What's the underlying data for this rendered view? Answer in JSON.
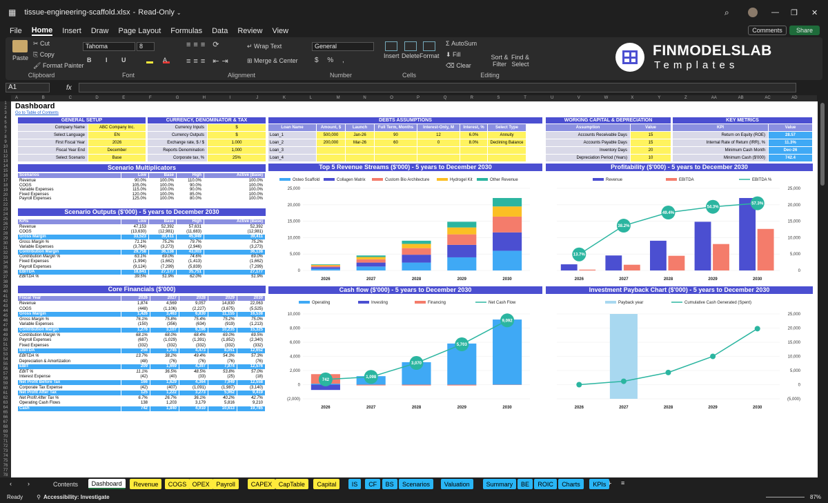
{
  "window": {
    "file_name": "tissue-engineering-scaffold.xlsx",
    "mode": "Read-Only"
  },
  "menu": [
    "File",
    "Home",
    "Insert",
    "Draw",
    "Page Layout",
    "Formulas",
    "Data",
    "Review",
    "View"
  ],
  "buttons": {
    "comments": "Comments",
    "share": "Share"
  },
  "ribbon": {
    "paste": "Paste",
    "cut": "Cut",
    "copy": "Copy",
    "format_painter": "Format Painter",
    "clipboard": "Clipboard",
    "font_name": "Tahoma",
    "font_size": "8",
    "font": "Font",
    "wrap": "Wrap Text",
    "merge": "Merge & Center",
    "alignment": "Alignment",
    "number_format": "General",
    "number": "Number",
    "insert": "Insert",
    "delete": "Delete",
    "format": "Format",
    "cells": "Cells",
    "autosum": "AutoSum",
    "fill": "Fill",
    "clear": "Clear",
    "sort": "Sort & Filter",
    "find": "Find & Select",
    "editing": "Editing"
  },
  "brand": {
    "name": "FINMODELSLAB",
    "sub": "Templates"
  },
  "name_box": "A1",
  "columns": [
    "A",
    "B",
    "C",
    "D",
    "E",
    "F",
    "G",
    "H",
    "I",
    "J",
    "K",
    "L",
    "M",
    "N",
    "O",
    "P",
    "Q",
    "R",
    "S",
    "T",
    "U",
    "V",
    "W",
    "X",
    "Y",
    "Z",
    "AA",
    "AB",
    "AC",
    "AD"
  ],
  "sheet": {
    "title": "Dashboard",
    "link": "Go to Table of Contents",
    "general": {
      "title": "GENERAL SETUP",
      "rows": [
        [
          "Company Name",
          "ABC Company Inc."
        ],
        [
          "Select Language",
          "EN"
        ],
        [
          "First Fiscal Year",
          "2026"
        ],
        [
          "Fiscal Year End",
          "December"
        ],
        [
          "Select Scenario",
          "Base"
        ]
      ]
    },
    "currency": {
      "title": "CURRENCY, DENOMINATOR & TAX",
      "rows": [
        [
          "Currency Inputs",
          "$"
        ],
        [
          "Currency Outputs",
          "$"
        ],
        [
          "Exchange rate, $ / $",
          "1.000"
        ],
        [
          "Reports Denomination",
          "1,000"
        ],
        [
          "Corporate tax, %",
          "25%"
        ]
      ]
    },
    "debts": {
      "title": "DEBTS ASSUMPTIONS",
      "headers": [
        "Loan Name",
        "Amount, $",
        "Launch",
        "Full Term, Months",
        "Interest-Only, M",
        "Interest, %",
        "Select Type"
      ],
      "rows": [
        [
          "Loan_1",
          "500,000",
          "Jan-26",
          "90",
          "12",
          "6.0%",
          "Annuity"
        ],
        [
          "Loan_2",
          "200,000",
          "Mar-26",
          "60",
          "0",
          "8.0%",
          "Declining Balance"
        ],
        [
          "Loan_3",
          "",
          "",
          "",
          "",
          "",
          ""
        ],
        [
          "Loan_4",
          "",
          "",
          "",
          "",
          "",
          ""
        ]
      ]
    },
    "wc": {
      "title": "WORKING CAPITAL & DEPRECIATION",
      "headers": [
        "Assumption",
        "Value"
      ],
      "rows": [
        [
          "Accounts Receivable Days",
          "15"
        ],
        [
          "Accounts Payable Days",
          "15"
        ],
        [
          "Inventory Days",
          "20"
        ],
        [
          "Depreciation Period (Years)",
          "10"
        ]
      ]
    },
    "kpi": {
      "title": "KEY METRICS",
      "headers": [
        "KPI",
        "Value"
      ],
      "rows": [
        [
          "Return on Equity (ROE)",
          "28.57"
        ],
        [
          "Internal Rate of Return (IRR), %",
          "11.3%"
        ],
        [
          "Minimum Cash Month",
          "Dec-26"
        ],
        [
          "Minimum Cash ($'000)",
          "742.4"
        ]
      ]
    },
    "multipliers": {
      "title": "Scenario Multiplicators",
      "headers": [
        "Scenarios",
        "Low",
        "Base",
        "High",
        "Active (Base)"
      ],
      "rows": [
        [
          "Revenue",
          "90.0%",
          "100.0%",
          "110.0%",
          "100.0%"
        ],
        [
          "COGS",
          "105.0%",
          "100.0%",
          "90.0%",
          "100.0%"
        ],
        [
          "Variable Expenses",
          "115.0%",
          "100.0%",
          "90.0%",
          "100.0%"
        ],
        [
          "Fixed Expenses",
          "120.0%",
          "100.0%",
          "85.0%",
          "100.0%"
        ],
        [
          "Payroll Expenses",
          "125.0%",
          "100.0%",
          "80.0%",
          "100.0%"
        ]
      ]
    },
    "outputs": {
      "title": "Scenario Outputs ($'000) - 5 years to December 2030",
      "headers": [
        "KPIs",
        "Low",
        "Base",
        "High",
        "Active (Base)"
      ],
      "rows": [
        [
          "Revenue",
          "47,153",
          "52,392",
          "57,631",
          "52,392",
          ""
        ],
        [
          "COGS",
          "(13,630)",
          "(12,981)",
          "(11,683)",
          "(12,981)",
          ""
        ],
        [
          "Gross Margin",
          "33,523",
          "39,411",
          "45,949",
          "39,411",
          "b"
        ],
        [
          "Gross Margin %",
          "71.1%",
          "75.2%",
          "79.7%",
          "75.2%",
          "i"
        ],
        [
          "Variable Expenses",
          "(3,764)",
          "(3,273)",
          "(2,946)",
          "(3,273)",
          ""
        ],
        [
          "Contribution Margin",
          "29,758",
          "36,138",
          "43,003",
          "36,138",
          "b"
        ],
        [
          "Contribution Margin %",
          "63.1%",
          "69.0%",
          "74.6%",
          "69.0%",
          "i"
        ],
        [
          "Fixed Expenses",
          "(1,994)",
          "(1,662)",
          "(1,413)",
          "(1,662)",
          ""
        ],
        [
          "Payroll Expenses",
          "(9,124)",
          "(7,299)",
          "(5,839)",
          "(7,299)",
          ""
        ],
        [
          "EBITDA",
          "18,641",
          "27,177",
          "35,751",
          "27,177",
          "b"
        ],
        [
          "EBITDA %",
          "39.5%",
          "51.9%",
          "62.0%",
          "51.9%",
          "i"
        ]
      ]
    },
    "core": {
      "title": "Core Financials ($'000)",
      "headers": [
        "Fiscal Year",
        "2026",
        "2027",
        "2028",
        "2029",
        "2030"
      ],
      "rows": [
        [
          "Revenue",
          "1,874",
          "4,569",
          "9,057",
          "14,830",
          "22,063",
          ""
        ],
        [
          "COGS",
          "(448)",
          "(1,106)",
          "(2,227)",
          "(3,675)",
          "(5,525)",
          ""
        ],
        [
          "Gross Margin",
          "1,426",
          "3,463",
          "6,830",
          "11,155",
          "16,538",
          "b"
        ],
        [
          "Gross Margin %",
          "76.1%",
          "75.8%",
          "75.4%",
          "75.2%",
          "75.0%",
          "i"
        ],
        [
          "Variable Expenses",
          "(150)",
          "(356)",
          "(634)",
          "(919)",
          "(1,213)",
          ""
        ],
        [
          "Contribution Margin",
          "1,276",
          "3,107",
          "6,196",
          "10,235",
          "15,325",
          "b"
        ],
        [
          "Contribution Margin %",
          "68.1%",
          "68.0%",
          "68.4%",
          "69.0%",
          "69.5%",
          "i"
        ],
        [
          "Payroll Expenses",
          "(687)",
          "(1,029)",
          "(1,391)",
          "(1,852)",
          "(2,340)",
          ""
        ],
        [
          "Fixed Expenses",
          "(332)",
          "(332)",
          "(332)",
          "(332)",
          "(332)",
          ""
        ],
        [
          "EBITDA",
          "256",
          "1,745",
          "4,473",
          "8,051",
          "12,652",
          "b"
        ],
        [
          "EBITDA %",
          "13.7%",
          "38.2%",
          "49.4%",
          "54.3%",
          "57.3%",
          "i"
        ],
        [
          "Depreciation & Amortization",
          "(48)",
          "(76)",
          "(76)",
          "(76)",
          "(76)",
          ""
        ],
        [
          "EBIT",
          "209",
          "1,669",
          "4,397",
          "7,974",
          "12,576",
          "b"
        ],
        [
          "EBIT %",
          "11.1%",
          "36.5%",
          "48.5%",
          "53.8%",
          "57.0%",
          "i"
        ],
        [
          "Interest Expense",
          "(42)",
          "(40)",
          "(33)",
          "(25)",
          "(18)",
          ""
        ],
        [
          "Net Profit Before Tax",
          "166",
          "1,629",
          "4,364",
          "7,949",
          "12,558",
          "b"
        ],
        [
          "Corporate Tax Expense",
          "(42)",
          "(407)",
          "(1,091)",
          "(1,987)",
          "(3,140)",
          ""
        ],
        [
          "Net Profit After Tax",
          "125",
          "1,222",
          "3,273",
          "5,962",
          "9,419",
          "b"
        ],
        [
          "Net Profit After Tax %",
          "6.7%",
          "26.7%",
          "36.1%",
          "40.2%",
          "42.7%",
          "i"
        ],
        [
          "Operating Cash Flows",
          "138",
          "1,203",
          "3,179",
          "5,816",
          "9,210",
          ""
        ],
        [
          "Cash",
          "742",
          "1,840",
          "4,910",
          "10,613",
          "19,785",
          "y"
        ]
      ]
    }
  },
  "chart_data": [
    {
      "type": "bar",
      "title": "Top 5 Revenue Streams ($'000) - 5 years to December 2030",
      "categories": [
        "2026",
        "2027",
        "2028",
        "2029",
        "2030"
      ],
      "ylim": [
        0,
        25000
      ],
      "yticks": [
        "0",
        "5,000",
        "10,000",
        "15,000",
        "20,000",
        "25,000"
      ],
      "series": [
        {
          "name": "Osteo Scaffold",
          "color": "#3fa9f5",
          "values": [
            500,
            1200,
            2400,
            4000,
            6000
          ]
        },
        {
          "name": "Collagen Matrix",
          "color": "#4b4fd1",
          "values": [
            500,
            1200,
            2400,
            3800,
            5600
          ]
        },
        {
          "name": "Custom Bio Architecture",
          "color": "#f47c6b",
          "values": [
            400,
            1000,
            2000,
            3200,
            4800
          ]
        },
        {
          "name": "Hydrogel Kit",
          "color": "#fbbf24",
          "values": [
            300,
            700,
            1300,
            2100,
            3100
          ]
        },
        {
          "name": "Other Revenue",
          "color": "#2bb5a0",
          "values": [
            174,
            469,
            957,
            1730,
            2563
          ]
        }
      ]
    },
    {
      "type": "bar",
      "title": "Profitability ($'000) - 5 years to December 2030",
      "categories": [
        "2026",
        "2027",
        "2028",
        "2029",
        "2030"
      ],
      "ylim": [
        0,
        25000
      ],
      "yticks": [
        "0",
        "5,000",
        "10,000",
        "15,000",
        "20,000",
        "25,000"
      ],
      "series": [
        {
          "name": "Revenue",
          "color": "#4b4fd1",
          "values": [
            1874,
            4569,
            9057,
            14830,
            22063
          ]
        },
        {
          "name": "EBITDA",
          "color": "#f47c6b",
          "values": [
            256,
            1745,
            4473,
            8051,
            12652
          ]
        }
      ],
      "line": {
        "name": "EBITDA %",
        "color": "#2bb5a0",
        "values": [
          13.7,
          38.2,
          49.4,
          54.3,
          57.3
        ],
        "labels": [
          "13.7%",
          "38.2%",
          "49.4%",
          "54.3%",
          "57.3%"
        ]
      }
    },
    {
      "type": "bar",
      "title": "Cash flow ($'000) - 5 years to December 2030",
      "categories": [
        "2026",
        "2027",
        "2028",
        "2029",
        "2030"
      ],
      "ylim": [
        -2000,
        10000
      ],
      "yticks": [
        "(2,000)",
        "0",
        "2,000",
        "4,000",
        "6,000",
        "8,000",
        "10,000"
      ],
      "series": [
        {
          "name": "Operating",
          "color": "#3fa9f5",
          "values": [
            138,
            1203,
            3179,
            5816,
            9210
          ]
        },
        {
          "name": "Investing",
          "color": "#4b4fd1",
          "values": [
            -750,
            0,
            0,
            0,
            0
          ]
        },
        {
          "name": "Financing",
          "color": "#f47c6b",
          "values": [
            1350,
            -105,
            -109,
            -113,
            -38
          ]
        }
      ],
      "line": {
        "name": "Net Cash Flow",
        "color": "#2bb5a0",
        "values": [
          742,
          1098,
          3070,
          5703,
          9092
        ],
        "labels": [
          "742",
          "1,098",
          "3,070",
          "5,703",
          "9,092"
        ]
      }
    },
    {
      "type": "bar",
      "title": "Investment Payback Chart ($'000) - 5 years to December 2030",
      "categories": [
        "2026",
        "2027",
        "2028",
        "2029",
        "2030"
      ],
      "ylim": [
        -5000,
        25000
      ],
      "yticks": [
        "(5,000)",
        "0",
        "5,000",
        "10,000",
        "15,000",
        "20,000",
        "25,000"
      ],
      "series": [
        {
          "name": "Payback year",
          "color": "#a8d8f0",
          "values": [
            0,
            1,
            0,
            0,
            0
          ]
        }
      ],
      "line": {
        "name": "Cumulative Cash Generated (Spent)",
        "color": "#2bb5a0",
        "values": [
          0,
          1200,
          4300,
          10000,
          19800
        ]
      }
    }
  ],
  "sheet_tabs": [
    [
      "Contents",
      "n"
    ],
    [
      "Dashboard",
      "a"
    ],
    [
      "Revenue",
      "y"
    ],
    [
      "COGS",
      "y"
    ],
    [
      "OPEX",
      "y"
    ],
    [
      "Payroll",
      "y"
    ],
    [
      "CAPEX",
      "y"
    ],
    [
      "CapTable",
      "y"
    ],
    [
      "Capital",
      "y"
    ],
    [
      "IS",
      "b"
    ],
    [
      "CF",
      "b"
    ],
    [
      "BS",
      "b"
    ],
    [
      "Scenarios",
      "b"
    ],
    [
      "Valuation",
      "b"
    ],
    [
      "Summary",
      "b"
    ],
    [
      "BE",
      "b"
    ],
    [
      "ROIC",
      "b"
    ],
    [
      "Charts",
      "b"
    ],
    [
      "KPIs",
      "b"
    ]
  ],
  "status": {
    "ready": "Ready",
    "accessibility": "Accessibility: Investigate",
    "zoom": "87%"
  }
}
